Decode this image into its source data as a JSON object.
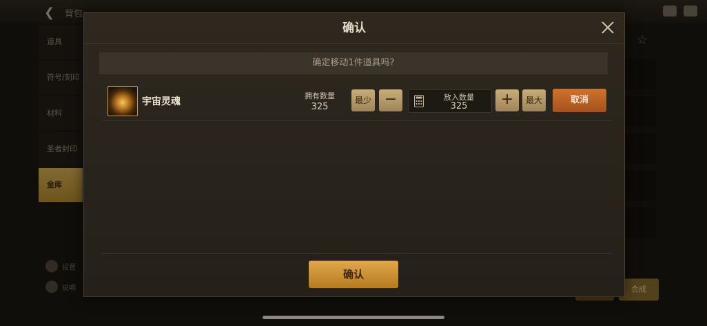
{
  "background": {
    "title": "背包",
    "tabs": [
      "道具",
      "符号/刻印",
      "材料",
      "圣者封印",
      "金库"
    ],
    "active_tab": "金库",
    "left_items": [
      "设置",
      "说明"
    ],
    "right_button": "合成"
  },
  "modal": {
    "title": "确认",
    "prompt": "确定移动1件道具吗?",
    "item": {
      "name": "宇宙灵魂",
      "owned_label": "拥有数量",
      "owned_value": "325",
      "min_label": "最少",
      "minus_label": "−",
      "qty_label": "放入数量",
      "qty_value": "325",
      "plus_label": "+",
      "max_label": "最大",
      "cancel_label": "取消"
    },
    "confirm_label": "确认"
  },
  "colors": {
    "accent_gold": "#e0a84a",
    "cancel_orange": "#d0722e",
    "panel_bg": "#2e281f"
  }
}
